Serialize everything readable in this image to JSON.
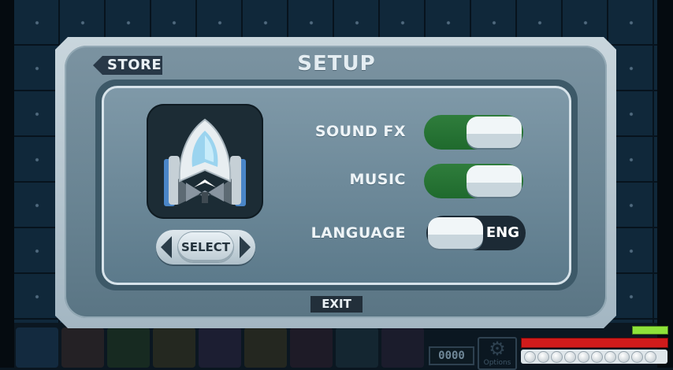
{
  "dialog": {
    "title": "SETUP",
    "store_label": "STORE",
    "exit_label": "EXIT"
  },
  "ship_selector": {
    "select_label": "SELECT"
  },
  "settings": {
    "sound_fx": {
      "label": "SOUND FX",
      "state": "on"
    },
    "music": {
      "label": "MUSIC",
      "state": "on"
    },
    "language": {
      "label": "LANGUAGE",
      "value": "ENG"
    }
  },
  "hud": {
    "counter": "0000",
    "options_label": "Options",
    "health_color": "#d11b1b",
    "energy_color": "#8ee23a",
    "ammo_dots": 10
  },
  "colors": {
    "toggle_on": "#2f7d3c",
    "dialog_bg": "#7b93a1",
    "dark_button": "#283847"
  }
}
